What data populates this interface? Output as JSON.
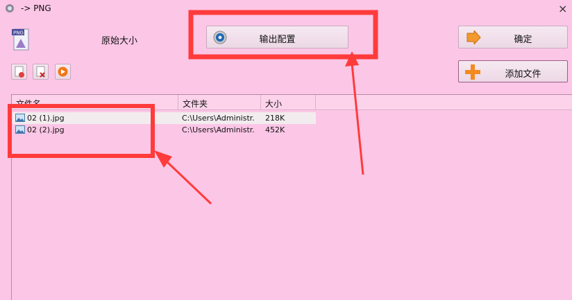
{
  "window": {
    "title": "-> PNG",
    "close_glyph": "×"
  },
  "header": {
    "original_size_label": "原始大小"
  },
  "buttons": {
    "output_config": "输出配置",
    "ok": "确定",
    "add_file": "添加文件"
  },
  "toolbar": {
    "icons": [
      "remove-doc-icon",
      "delete-doc-icon",
      "play-icon"
    ]
  },
  "list": {
    "columns": [
      "文件名",
      "文件夹",
      "大小",
      ""
    ],
    "rows": [
      {
        "name": "02 (1).jpg",
        "folder": "C:\\Users\\Administr...",
        "size": "218K"
      },
      {
        "name": "02 (2).jpg",
        "folder": "C:\\Users\\Administr...",
        "size": "452K"
      }
    ]
  },
  "colors": {
    "background": "#fcc6e6",
    "annotation": "#ff3b3b"
  }
}
